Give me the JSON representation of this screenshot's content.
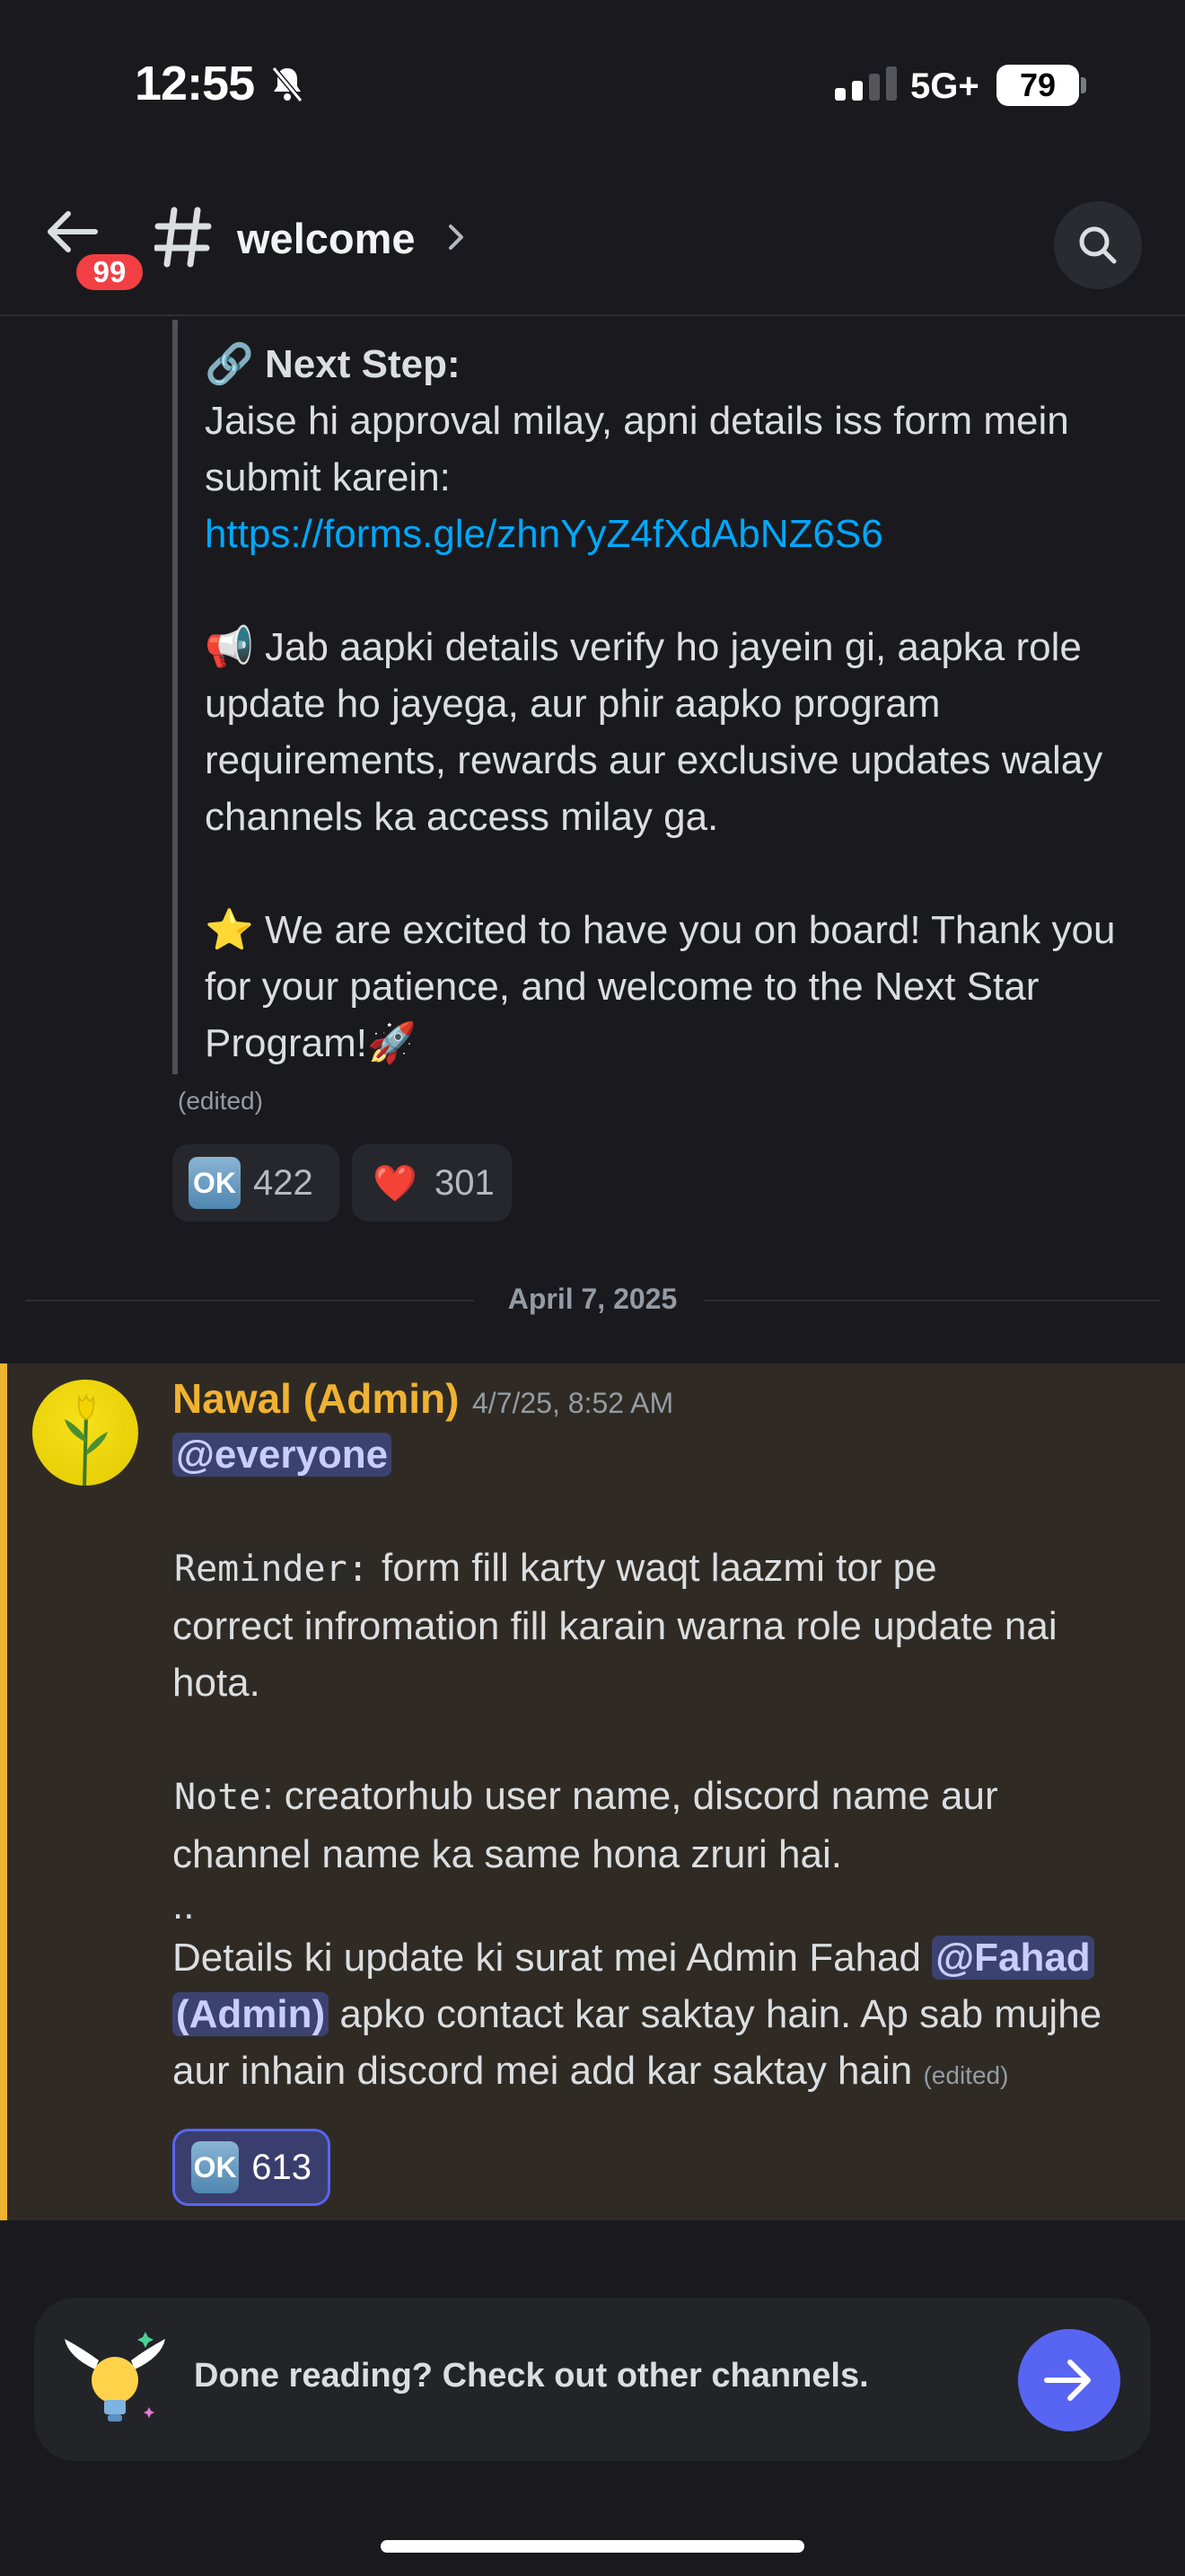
{
  "status_bar": {
    "time": "12:55",
    "network": "5G+",
    "battery": "79"
  },
  "header": {
    "unread_badge": "99",
    "channel_name": "welcome"
  },
  "embed": {
    "lines": [
      {
        "prefix": "🔗 ",
        "bold": "Next Step:"
      },
      {
        "text": "Jaise hi approval milay, apni details iss form mein"
      },
      {
        "text": "submit karein:"
      },
      {
        "link": "https://forms.gle/zhnYyZ4fXdAbNZ6S6"
      },
      {
        "text": ""
      },
      {
        "text": "📢  Jab aapki details verify ho jayein gi, aapka role"
      },
      {
        "text": "update ho jayega, aur phir aapko program"
      },
      {
        "text": "requirements, rewards aur exclusive updates walay"
      },
      {
        "text": "channels ka access milay ga."
      },
      {
        "text": ""
      },
      {
        "text": "⭐ We are excited to have you on board! Thank you"
      },
      {
        "text": "for your patience, and welcome to the Next Star"
      },
      {
        "text": "Program!🚀"
      }
    ],
    "edited": "(edited)",
    "reactions": [
      {
        "emoji": "OK",
        "count": "422"
      },
      {
        "emoji": "❤️",
        "count": "301"
      }
    ]
  },
  "date_divider": "April 7, 2025",
  "message": {
    "author": "Nawal (Admin)",
    "timestamp": "4/7/25, 8:52 AM",
    "mention_everyone": "@everyone",
    "reminder_label": "Reminder:",
    "reminder_text_1": " form fill karty waqt laazmi tor pe",
    "reminder_text_2": "correct infromation fill karain warna role update nai",
    "reminder_text_3": "hota.",
    "note_label": "Note",
    "note_text_1": ": creatorhub user name, discord name aur",
    "note_text_2": "channel name ka same hona zruri hai.",
    "dots": "..",
    "details_text_1": "Details ki update ki surat mei Admin Fahad ",
    "mention_fahad_1": "@Fahad",
    "mention_fahad_2": "(Admin)",
    "details_text_2": "  apko contact kar saktay hain. Ap sab mujhe",
    "details_text_3": "aur inhain discord mei add kar saktay hain",
    "edited": "(edited)",
    "reaction": {
      "emoji": "OK",
      "count": "613"
    }
  },
  "cta": {
    "text": "Done reading? Check out other channels."
  },
  "colors": {
    "accent": "#5865f2",
    "author": "#f0b232",
    "link": "#00a8fc",
    "badge": "#f23f43",
    "highlight_bg": "#2f2b24"
  }
}
